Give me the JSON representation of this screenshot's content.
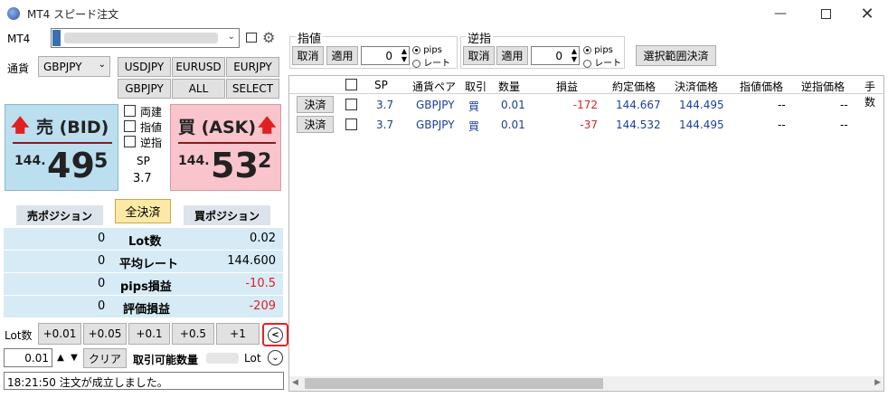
{
  "window": {
    "title": "MT4 スピード注文"
  },
  "account": {
    "label": "MT4"
  },
  "currency": {
    "label": "通貨",
    "selected": "GBPJPY"
  },
  "pairs": [
    "USDJPY",
    "EURUSD",
    "EURJPY",
    "GBPJPY",
    "ALL",
    "SELECT"
  ],
  "sell": {
    "label": "売 (BID)",
    "price_prefix": "144.",
    "price_main": "49",
    "price_sup": "5"
  },
  "buy": {
    "label": "買 (ASK)",
    "price_prefix": "144.",
    "price_main": "53",
    "price_sup": "2"
  },
  "options": {
    "ryoudate": "両建",
    "sashine": "指値",
    "gyakusashi": "逆指"
  },
  "spread": {
    "label": "SP",
    "value": "3.7"
  },
  "positions": {
    "sell_label": "売ポジション",
    "close_all": "全決済",
    "buy_label": "買ポジション"
  },
  "stats": [
    {
      "label": "Lot数",
      "sell": "0",
      "buy": "0.02",
      "buy_color": "#000000"
    },
    {
      "label": "平均レート",
      "sell": "0",
      "buy": "144.600",
      "buy_color": "#000000"
    },
    {
      "label": "pips損益",
      "sell": "0",
      "buy": "-10.5",
      "buy_color": "#e02020"
    },
    {
      "label": "評価損益",
      "sell": "0",
      "buy": "-209",
      "buy_color": "#e02020"
    }
  ],
  "lot": {
    "label": "Lot数",
    "inc": [
      "+0.01",
      "+0.05",
      "+0.1",
      "+0.5",
      "+1"
    ],
    "value": "0.01",
    "clear": "クリア",
    "available_label": "取引可能数量",
    "unit": "Lot"
  },
  "status": {
    "message": "18:21:50 注文が成立しました。"
  },
  "limit": {
    "title": "指値",
    "cancel": "取消",
    "apply": "適用",
    "value": "0",
    "pips": "pips",
    "rate": "レート"
  },
  "stop": {
    "title": "逆指",
    "cancel": "取消",
    "apply": "適用",
    "value": "0",
    "pips": "pips",
    "rate": "レート"
  },
  "select_close": "選択範囲決済",
  "table": {
    "headers": [
      "",
      "SP",
      "通貨ペア",
      "取引",
      "数量",
      "損益",
      "約定価格",
      "決済価格",
      "指値価格",
      "逆指価格",
      "手数"
    ],
    "close_label": "決済",
    "rows": [
      {
        "sp": "3.7",
        "pair": "GBPJPY",
        "side": "買",
        "qty": "0.01",
        "pl": "-172",
        "entry": "144.667",
        "exit": "144.495",
        "limit": "--",
        "stop": "--"
      },
      {
        "sp": "3.7",
        "pair": "GBPJPY",
        "side": "買",
        "qty": "0.01",
        "pl": "-37",
        "entry": "144.532",
        "exit": "144.495",
        "limit": "--",
        "stop": "--"
      }
    ]
  },
  "colors": {
    "sell_bg": "#bcdff0",
    "buy_bg": "#f9c4cc",
    "red": "#e02020",
    "blue": "#1a3fa0",
    "highlight": "#e82020"
  }
}
